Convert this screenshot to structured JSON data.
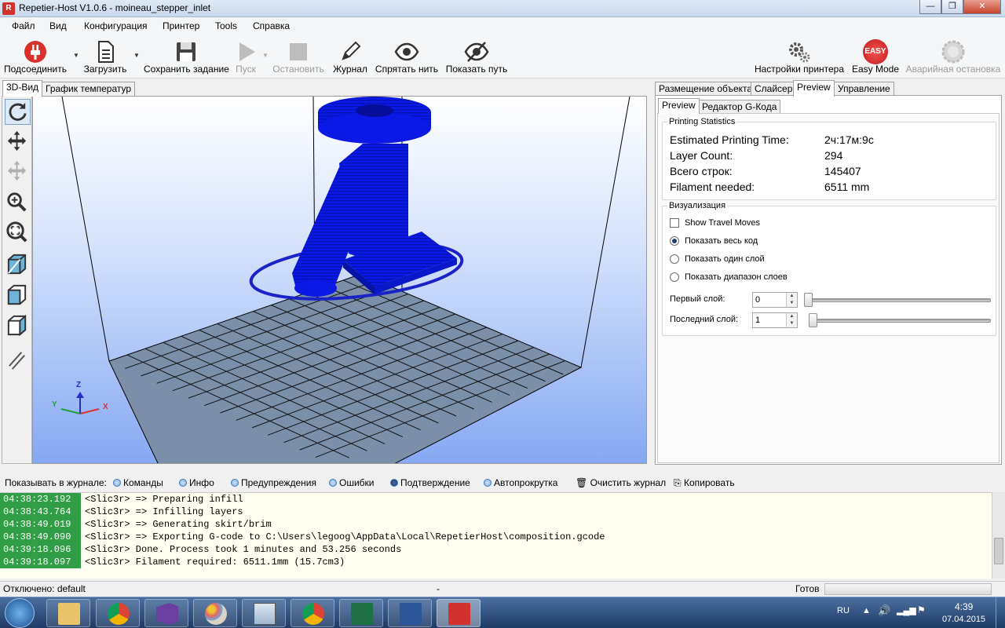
{
  "window": {
    "title": "Repetier-Host V1.0.6 - moineau_stepper_inlet",
    "app_icon": "R",
    "min": "—",
    "max": "❐",
    "close": "✕"
  },
  "menu": [
    "Файл",
    "Вид",
    "Конфигурация",
    "Принтер",
    "Tools",
    "Справка"
  ],
  "toolbar": {
    "connect": "Подсоединить",
    "load": "Загрузить",
    "save_job": "Сохранить задание",
    "start": "Пуск",
    "stop": "Остановить",
    "log": "Журнал",
    "hide_filament": "Спрятать нить",
    "show_path": "Показать путь",
    "printer_settings": "Настройки принтера",
    "easy_mode": "Easy Mode",
    "easy_badge": "EASY",
    "emergency": "Аварийная остановка"
  },
  "left_tabs": [
    "3D-Вид",
    "График температур"
  ],
  "axes": {
    "x": "X",
    "y": "Y",
    "z": "Z"
  },
  "right_tabs": [
    "Размещение объекта",
    "Слайсер",
    "Preview",
    "Управление"
  ],
  "preview_tabs": [
    "Preview",
    "Редактор G-Кода"
  ],
  "stats": {
    "title": "Printing Statistics",
    "rows": [
      {
        "label": "Estimated Printing Time:",
        "value": "2ч:17м:9с"
      },
      {
        "label": "Layer Count:",
        "value": "294"
      },
      {
        "label": "Всего строк:",
        "value": "145407"
      },
      {
        "label": "Filament needed:",
        "value": "6511 mm"
      }
    ]
  },
  "visualization": {
    "title": "Визуализация",
    "show_travel": "Show Travel Moves",
    "options": [
      "Показать весь код",
      "Показать один слой",
      "Показать диапазон слоев"
    ],
    "first_layer_label": "Первый слой:",
    "first_layer_value": "0",
    "last_layer_label": "Последний слой:",
    "last_layer_value": "1"
  },
  "log": {
    "show_label": "Показывать в журнале:",
    "options": [
      "Команды",
      "Инфо",
      "Предупреждения",
      "Ошибки",
      "Подтверждение",
      "Автопрокрутка"
    ],
    "clear": "Очистить журнал",
    "copy": "Копировать",
    "lines": [
      {
        "time": "04:38:23.192",
        "msg": "<Slic3r> => Preparing infill"
      },
      {
        "time": "04:38:43.764",
        "msg": "<Slic3r> => Infilling layers"
      },
      {
        "time": "04:38:49.019",
        "msg": "<Slic3r> => Generating skirt/brim"
      },
      {
        "time": "04:38:49.090",
        "msg": "<Slic3r> => Exporting G-code to C:\\Users\\legoog\\AppData\\Local\\RepetierHost\\composition.gcode"
      },
      {
        "time": "04:39:18.096",
        "msg": "<Slic3r> Done. Process took 1 minutes and 53.256 seconds"
      },
      {
        "time": "04:39:18.097",
        "msg": "<Slic3r> Filament required: 6511.1mm (15.7cm3)"
      }
    ]
  },
  "status": {
    "left": "Отключено: default",
    "mid": "-",
    "right": "Готов"
  },
  "taskbar": {
    "lang": "RU",
    "time": "4:39",
    "date": "07.04.2015"
  }
}
